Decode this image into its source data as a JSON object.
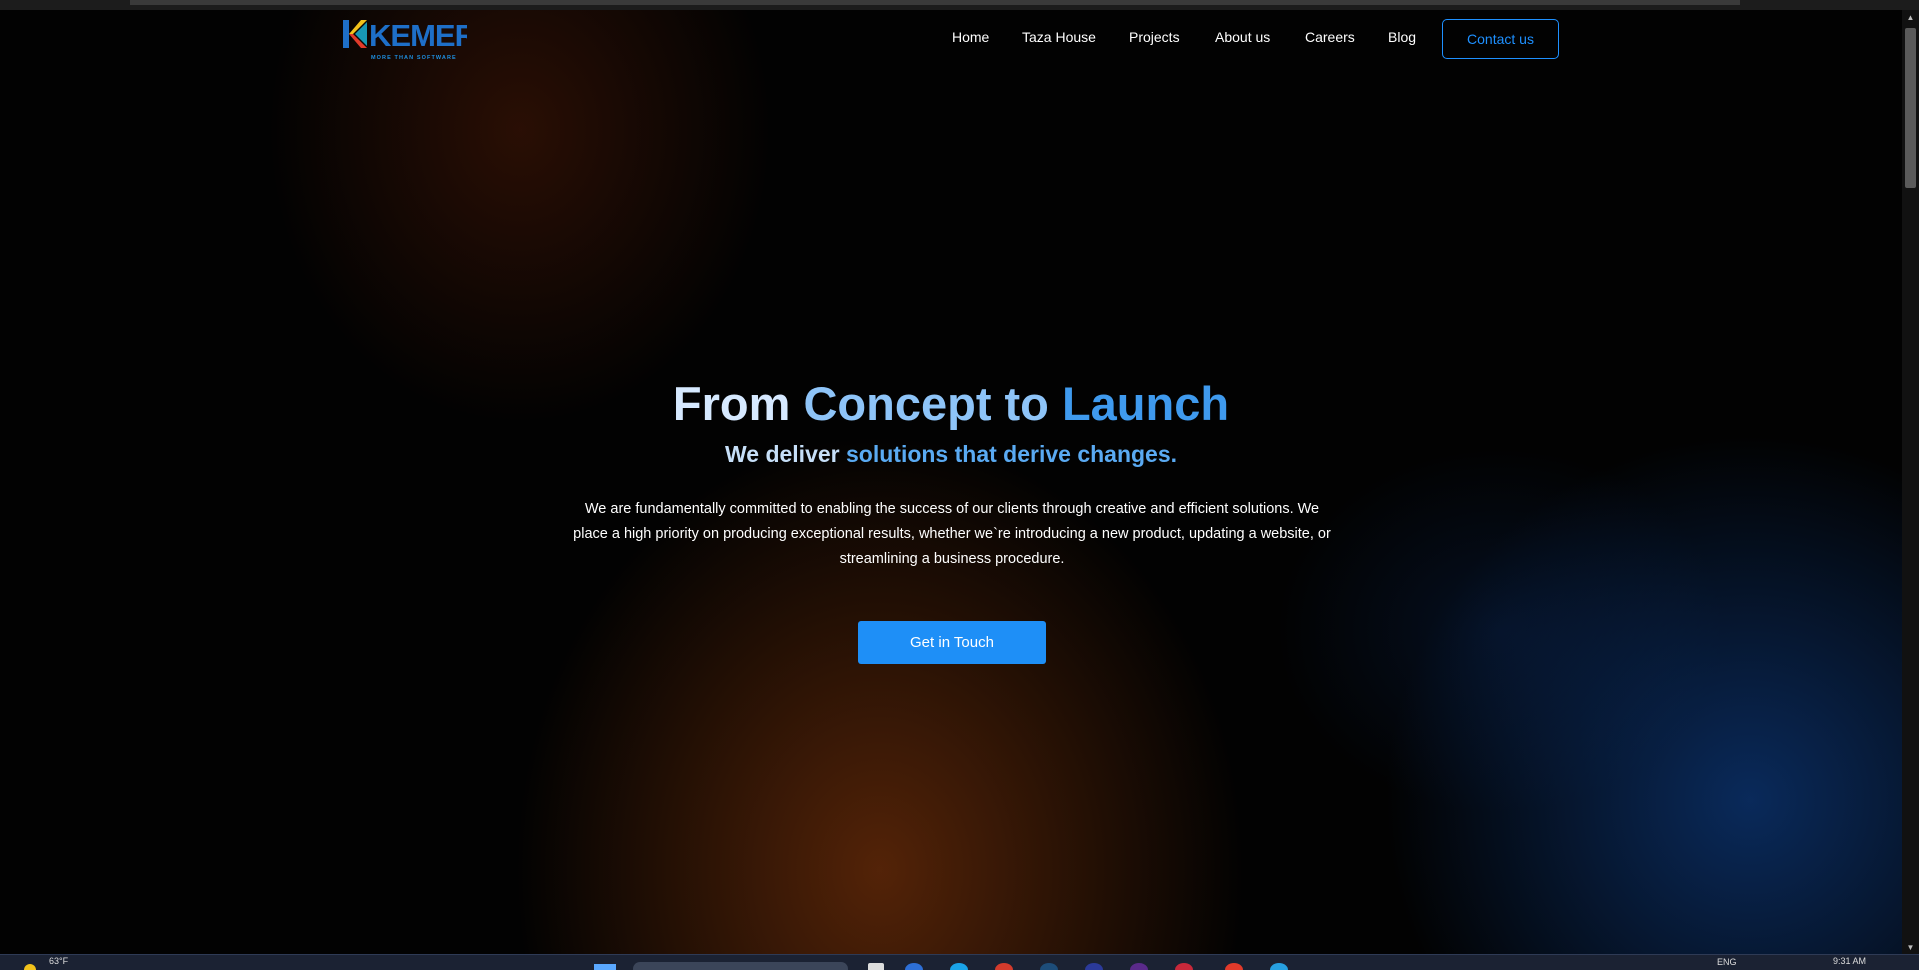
{
  "brand": {
    "logo_text": "KEMER",
    "tagline": "MORE THAN SOFTWARE",
    "colors": {
      "blue": "#1e6fc8",
      "yellow": "#f2c21b",
      "red": "#e03a2a",
      "teal": "#1aa9c9"
    }
  },
  "nav": {
    "items": [
      {
        "label": "Home"
      },
      {
        "label": "Taza House"
      },
      {
        "label": "Projects"
      },
      {
        "label": "About us"
      },
      {
        "label": "Careers"
      },
      {
        "label": "Blog"
      }
    ],
    "contact_label": "Contact us"
  },
  "hero": {
    "title_part1": "From ",
    "title_part2": "Concept to ",
    "title_part3": "Launch",
    "subtitle_part1": "We deliver ",
    "subtitle_part2": "solutions that derive changes.",
    "description": "We are fundamentally committed to enabling the success of our clients through creative and efficient solutions. We place a high priority on producing exceptional results, whether we`re introducing a new product, updating a website, or streamlining a business procedure.",
    "cta_label": "Get in Touch"
  },
  "theme": {
    "accent": "#1e8ff7",
    "background": "#000000",
    "glow_orange": "#963e0c",
    "glow_blue": "#0c3778"
  },
  "taskbar": {
    "weather": "63°F",
    "language": "ENG",
    "time": "9:31 AM"
  }
}
